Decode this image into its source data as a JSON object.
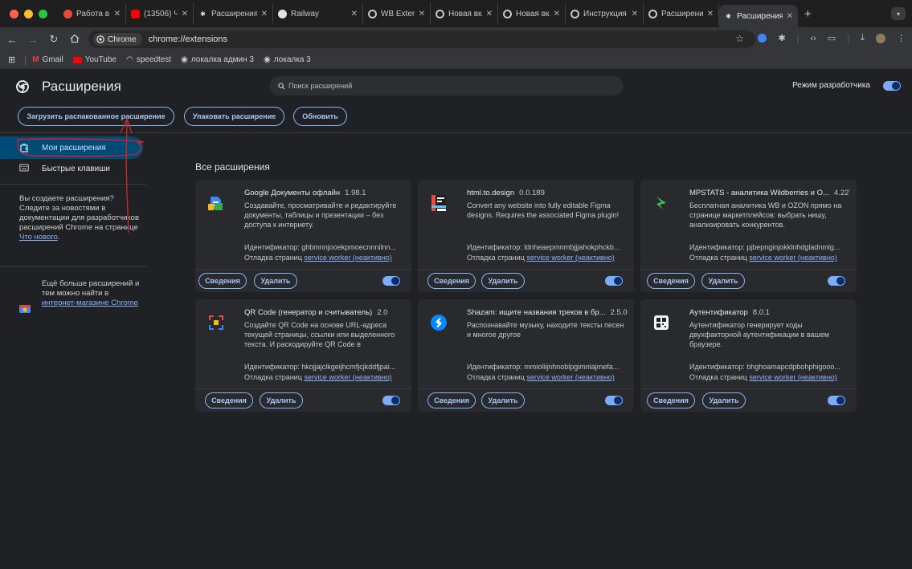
{
  "tabs": [
    {
      "title": "Работа в Би",
      "icon": "red-circle-icon",
      "active": false
    },
    {
      "title": "(13506) ЧТО",
      "icon": "youtube-icon",
      "active": false
    },
    {
      "title": "Расширения",
      "icon": "puzzle-icon",
      "active": false
    },
    {
      "title": "Railway",
      "icon": "railway-icon",
      "active": false
    },
    {
      "title": "WB Extensio",
      "icon": "chrome-icon",
      "active": false
    },
    {
      "title": "Новая вклад",
      "icon": "chrome-icon",
      "active": false
    },
    {
      "title": "Новая вклад",
      "icon": "chrome-icon",
      "active": false
    },
    {
      "title": "Инструкция",
      "icon": "chrome-icon",
      "active": false
    },
    {
      "title": "Расширение",
      "icon": "chrome-icon",
      "active": false
    },
    {
      "title": "Расширения",
      "icon": "puzzle-icon",
      "active": true
    }
  ],
  "toolbar": {
    "chip_label": "Chrome",
    "url": "chrome://extensions"
  },
  "bookmarks": [
    {
      "label": "Gmail",
      "icon": "gmail-icon"
    },
    {
      "label": "YouTube",
      "icon": "youtube-icon"
    },
    {
      "label": "speedtest",
      "icon": "speedtest-icon"
    },
    {
      "label": "локалка админ 3",
      "icon": "globe-icon"
    },
    {
      "label": "локалка 3",
      "icon": "globe-icon"
    }
  ],
  "header": {
    "title": "Расширения",
    "search_placeholder": "Поиск расширений",
    "dev_mode_label": "Режим разработчика"
  },
  "actions": {
    "load_unpacked": "Загрузить распакованное расширение",
    "pack": "Упаковать расширение",
    "update": "Обновить"
  },
  "sidebar": {
    "items": [
      {
        "label": "Мои расширения"
      },
      {
        "label": "Быстрые клавиши"
      }
    ],
    "dev_text_1": "Вы создаете расширения? Следите за новостями в документации для разработчиков расширений Chrome на странице ",
    "dev_link": "Что нового",
    "dev_text_2": ".",
    "store_text": "Ещё больше расширений и тем можно найти в ",
    "store_link": "интернет-магазине Chrome"
  },
  "section_title": "Все расширения",
  "card_labels": {
    "details": "Сведения",
    "remove": "Удалить",
    "debug_prefix": "Отладка страниц ",
    "service_worker": "service worker (неактивно)"
  },
  "extensions": [
    {
      "name": "Google Документы офлайн",
      "version": "1.98.1",
      "description": "Создавайте, просматривайте и редактируйте документы, таблицы и презентации – без доступа к интернету.",
      "id": "Идентификатор: ghbmnnjooekpmoecnnnilnn...",
      "icon": "google-docs-icon",
      "enabled": true
    },
    {
      "name": "html.to.design",
      "version": "0.0.189",
      "description": "Convert any website into fully editable Figma designs. Requires the associated Figma plugin!",
      "id": "Идентификатор: ldnheaepmnmbjjjahokphckb...",
      "icon": "html-to-design-icon",
      "enabled": true
    },
    {
      "name": "MPSTATS - аналитика Wildberries и O...",
      "version": "4.227",
      "description": "Бесплатная аналитика WB и OZON прямо на странице маркетплейсов: выбрать нишу, анализировать конкурентов.",
      "id": "Идентификатор: pjbepnginjokklnhdgladnmlg...",
      "icon": "mpstats-icon",
      "enabled": true
    },
    {
      "name": "QR Code (генератор и считыватель)",
      "version": "2.0",
      "description": "Создайте QR Code на основе URL-адреса текущей страницы, ссылки или выделенного текста. И раскодируйте QR Code в",
      "id": "Идентификатор: hkojjajclkgeijhcmfjcjkddfjpai...",
      "icon": "qr-code-icon",
      "enabled": true
    },
    {
      "name": "Shazam: ищите названия треков в бр...",
      "version": "2.5.0",
      "description": "Распознавайте музыку, находите тексты песен и многое другое",
      "id": "Идентификатор: mmioliijnhnoblpgimnlajmefa...",
      "icon": "shazam-icon",
      "enabled": true
    },
    {
      "name": "Аутентификатор",
      "version": "8.0.1",
      "description": "Аутентификатор генерирует коды двухфакторной аутентификации в вашем браузере.",
      "id": "Идентификатор: bhghoamapcdpbohphigooo...",
      "icon": "authenticator-icon",
      "enabled": true
    }
  ],
  "colors": {
    "background": "#202124",
    "card": "#292a2d",
    "accent": "#8ab4f8",
    "active_nav": "#004a77",
    "annotation": "#c5272d"
  }
}
